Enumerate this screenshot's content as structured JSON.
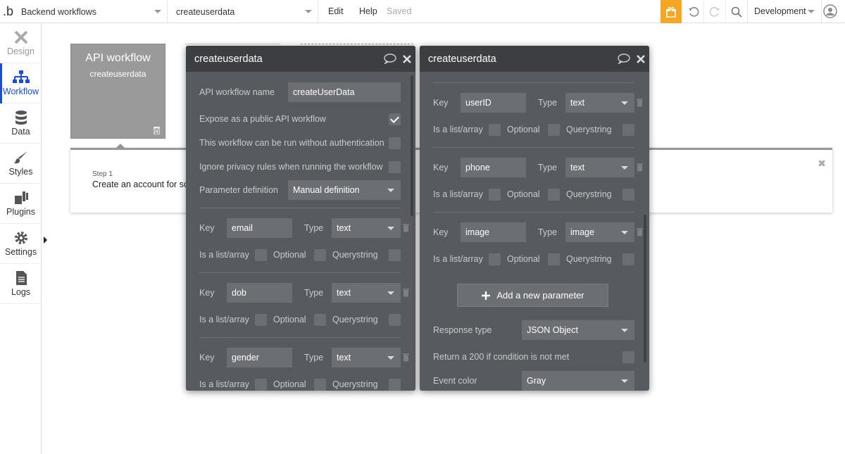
{
  "topbar": {
    "page_select": "Backend workflows",
    "workflow_select": "createuserdata",
    "menu_edit": "Edit",
    "menu_help": "Help",
    "status": "Saved",
    "environment": "Development"
  },
  "sidebar": {
    "items": [
      {
        "label": "Design",
        "icon": "design-icon",
        "state": "disabled"
      },
      {
        "label": "Workflow",
        "icon": "workflow-icon",
        "state": "active"
      },
      {
        "label": "Data",
        "icon": "data-icon",
        "state": "normal"
      },
      {
        "label": "Styles",
        "icon": "styles-icon",
        "state": "normal"
      },
      {
        "label": "Plugins",
        "icon": "plugins-icon",
        "state": "normal"
      },
      {
        "label": "Settings",
        "icon": "settings-icon",
        "state": "normal"
      },
      {
        "label": "Logs",
        "icon": "logs-icon",
        "state": "normal"
      }
    ]
  },
  "canvas": {
    "api_card": {
      "title": "API workflow",
      "subtitle": "createuserdata"
    },
    "step": {
      "label": "Step 1",
      "text": "Create an account for so"
    }
  },
  "panel_left": {
    "title": "createuserdata",
    "api_name_label": "API workflow name",
    "api_name_value": "createUserData",
    "expose_label": "Expose as a public API workflow",
    "expose_checked": true,
    "no_auth_label": "This workflow can be run without authentication",
    "no_auth_checked": false,
    "ignore_privacy_label": "Ignore privacy rules when running the workflow",
    "ignore_privacy_checked": false,
    "param_def_label": "Parameter definition",
    "param_def_value": "Manual definition",
    "params": [
      {
        "key_label": "Key",
        "key": "email",
        "type_label": "Type",
        "type": "text",
        "list_label": "Is a list/array",
        "optional_label": "Optional",
        "querystring_label": "Querystring"
      },
      {
        "key_label": "Key",
        "key": "dob",
        "type_label": "Type",
        "type": "text",
        "list_label": "Is a list/array",
        "optional_label": "Optional",
        "querystring_label": "Querystring"
      },
      {
        "key_label": "Key",
        "key": "gender",
        "type_label": "Type",
        "type": "text",
        "list_label": "Is a list/array",
        "optional_label": "Optional",
        "querystring_label": "Querystring"
      }
    ]
  },
  "panel_right": {
    "title": "createuserdata",
    "params": [
      {
        "key_label": "Key",
        "key": "userID",
        "type_label": "Type",
        "type": "text",
        "list_label": "Is a list/array",
        "optional_label": "Optional",
        "querystring_label": "Querystring"
      },
      {
        "key_label": "Key",
        "key": "phone",
        "type_label": "Type",
        "type": "text",
        "list_label": "Is a list/array",
        "optional_label": "Optional",
        "querystring_label": "Querystring"
      },
      {
        "key_label": "Key",
        "key": "image",
        "type_label": "Type",
        "type": "image",
        "list_label": "Is a list/array",
        "optional_label": "Optional",
        "querystring_label": "Querystring"
      }
    ],
    "add_param_label": "Add a new parameter",
    "response_type_label": "Response type",
    "response_type_value": "JSON Object",
    "return200_label": "Return a 200 if condition is not met",
    "event_color_label": "Event color",
    "event_color_value": "Gray"
  },
  "colors": {
    "accent": "#1a4dd6",
    "gift": "#f5a623",
    "panel_bg": "#575a5e",
    "panel_header": "#3c3e42",
    "field_bg": "#6b6e72"
  }
}
